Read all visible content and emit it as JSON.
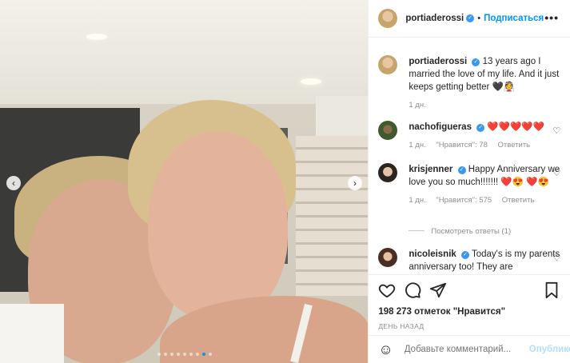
{
  "header": {
    "username": "portiaderossi",
    "separator": "•",
    "follow_label": "Подписаться",
    "more": "•••"
  },
  "comments": [
    {
      "username": "portiaderossi",
      "text": "13 years ago I married the love of my life. And it just keeps getting better 🖤👰",
      "time": "1 дн."
    },
    {
      "username": "nachofigueras",
      "text": "❤️❤️❤️❤️❤️",
      "time": "1 дн.",
      "likes": "\"Нравится\": 78",
      "reply": "Ответить"
    },
    {
      "username": "krisjenner",
      "text": "Happy Anniversary we love you so much!!!!!!! ❤️😍 ❤️😍",
      "time": "1 дн.",
      "likes": "\"Нравится\": 575",
      "reply": "Ответить"
    },
    {
      "username": "nicoleisnik",
      "text": "Today's is my parents anniversary too! They are"
    }
  ],
  "view_replies": "Посмотреть ответы (1)",
  "likes_count": "198 273 отметок \"Нравится\"",
  "post_date": "ДЕНЬ НАЗАД",
  "comment_input": {
    "placeholder": "Добавьте комментарий..."
  },
  "publish_label": "Опубликовать",
  "carousel": {
    "total": 9,
    "active_index": 7,
    "prev": "‹",
    "next": "›"
  },
  "colors": {
    "accent": "#0095f6",
    "verified": "#3897f0",
    "muted": "#8e8e8e"
  },
  "icons": [
    "heart-icon",
    "comment-icon",
    "share-icon",
    "bookmark-icon",
    "smiley-icon",
    "verified-badge-icon"
  ]
}
